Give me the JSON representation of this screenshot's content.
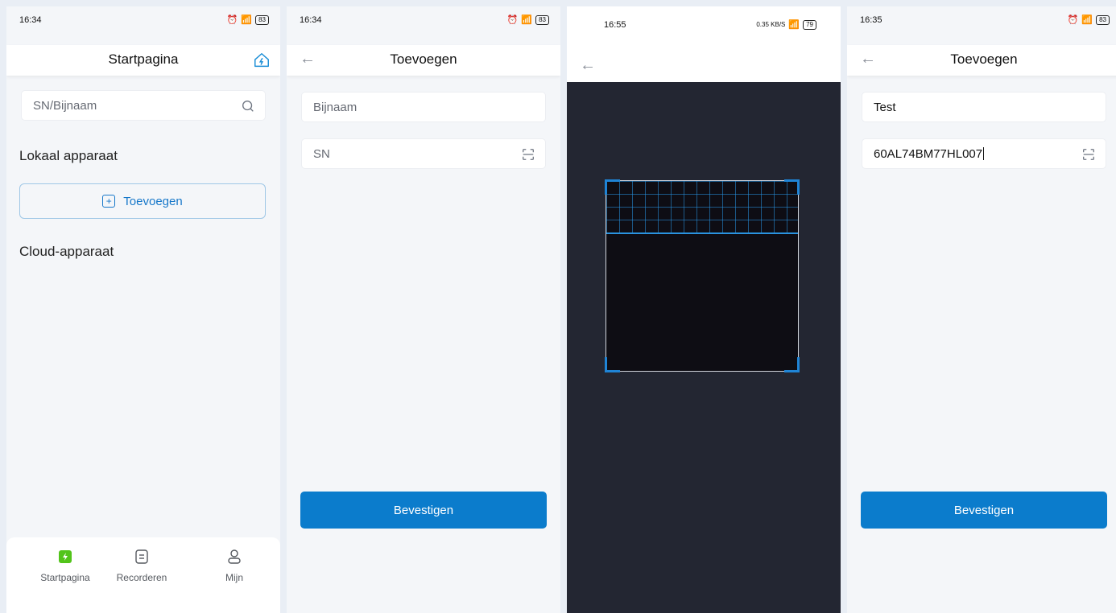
{
  "screens": [
    {
      "status": {
        "time": "16:34",
        "battery": "83"
      },
      "header": {
        "title": "Startpagina"
      },
      "search": {
        "placeholder": "SN/Bijnaam"
      },
      "local_section": "Lokaal apparaat",
      "add_button": "Toevoegen",
      "cloud_section": "Cloud-apparaat",
      "nav": [
        {
          "label": "Startpagina",
          "icon": "bolt-icon",
          "active": true
        },
        {
          "label": "Recorderen",
          "icon": "document-icon"
        },
        {
          "label": "Mijn",
          "icon": "user-icon"
        }
      ]
    },
    {
      "status": {
        "time": "16:34",
        "battery": "83"
      },
      "header": {
        "title": "Toevoegen"
      },
      "nickname": {
        "placeholder": "Bijnaam",
        "value": ""
      },
      "sn": {
        "placeholder": "SN",
        "value": ""
      },
      "confirm": "Bevestigen"
    },
    {
      "status": {
        "time": "16:55",
        "net": "0.35 KB/S",
        "battery": "79"
      }
    },
    {
      "status": {
        "time": "16:35",
        "battery": "83"
      },
      "header": {
        "title": "Toevoegen"
      },
      "nickname": {
        "value": "Test"
      },
      "sn": {
        "value": "60AL74BM77HL007"
      },
      "confirm": "Bevestigen"
    }
  ],
  "colors": {
    "accent": "#0b7ccc",
    "scan_bg": "#232632",
    "active_nav": "#52c41a"
  }
}
